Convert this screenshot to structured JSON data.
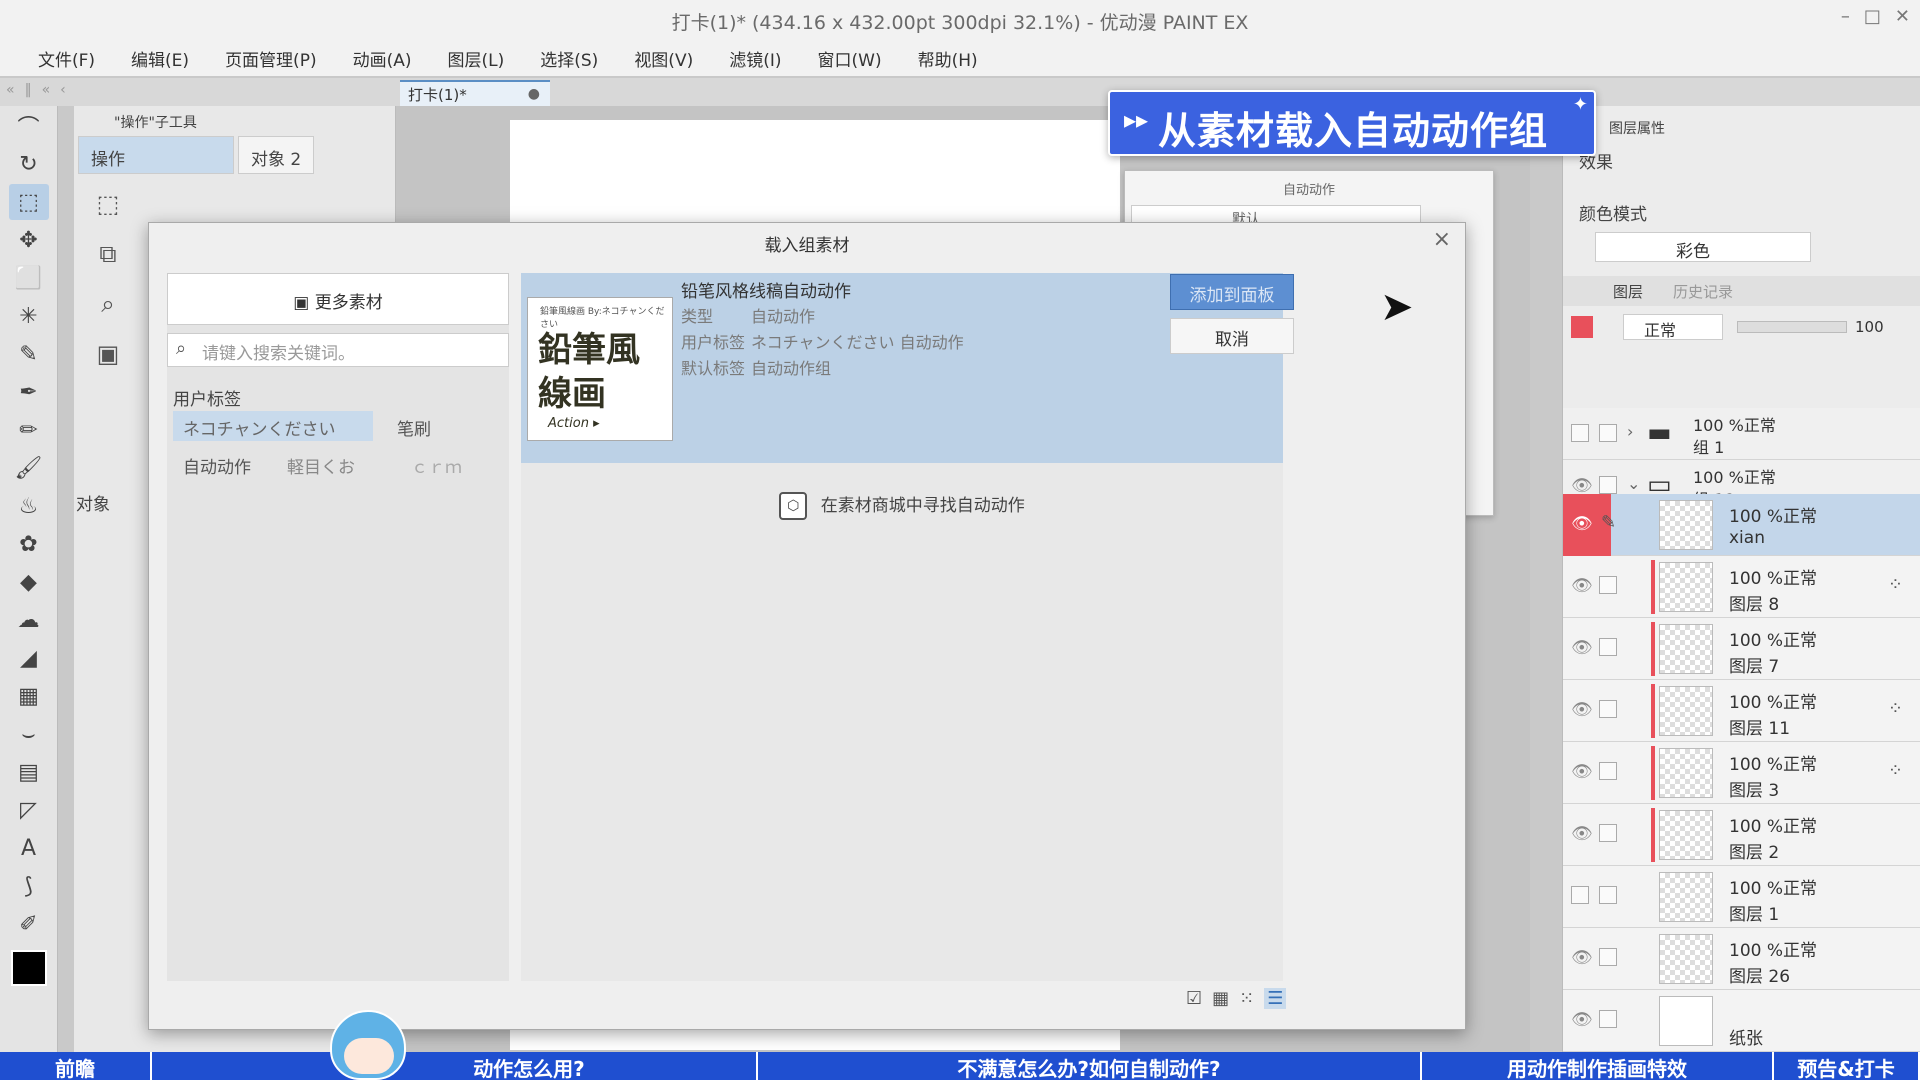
{
  "window": {
    "title": "打卡(1)* (434.16 x 432.00pt 300dpi 32.1%)  - 优动漫 PAINT EX",
    "controls": [
      "–",
      "□",
      "✕"
    ]
  },
  "menu": [
    "文件(F)",
    "编辑(E)",
    "页面管理(P)",
    "动画(A)",
    "图层(L)",
    "选择(S)",
    "视图(V)",
    "滤镜(I)",
    "窗口(W)",
    "帮助(H)"
  ],
  "doc_tab": {
    "label": "打卡(1)*",
    "dot": "●"
  },
  "subtool": {
    "header": "\"操作\"子工具",
    "tab_operate": "操作",
    "tab_object": "对象 2",
    "object_label": "对象"
  },
  "banner": {
    "text": "从素材载入自动动作组"
  },
  "auto_action_panel": {
    "title": "自动动作",
    "select": "默认"
  },
  "dialog": {
    "title": "载入组素材",
    "more_materials": "更多素材",
    "search_placeholder": "请键入搜索关键词。",
    "user_tags_label": "用户标签",
    "tags": [
      "ネコチャンください",
      "笔刷",
      "自动动作",
      "軽目くお",
      "ｃｒｍ"
    ],
    "item": {
      "title": "铅笔风格线稿自动动作",
      "type_key": "类型",
      "type_value": "自动动作",
      "user_tags_key": "用户标签",
      "user_tags_value": "ネコチャンください  自动动作",
      "default_tags_key": "默认标签",
      "default_tags_value": "自动动作组",
      "thumb_top": "鉛筆風線画 By:ネコチャンください",
      "thumb_line1": "鉛筆風",
      "thumb_line2": "線画",
      "thumb_action": "Action ▸"
    },
    "find_in_store": "在素材商城中寻找自动动作",
    "add_button": "添加到面板",
    "cancel_button": "取消"
  },
  "right_panel": {
    "layer_property": "图层属性",
    "effect_label": "效果",
    "color_mode_label": "颜色模式",
    "color_mode_value": "彩色",
    "layers_tab": "图层",
    "history_tab": "历史记录",
    "blend_mode": "正常",
    "opacity": "100",
    "folders": [
      {
        "line1": "100 %正常",
        "line2": "组 1"
      },
      {
        "line1": "100 %正常",
        "line2": "组 18"
      }
    ],
    "layers": [
      {
        "line1": "100 %正常",
        "line2": "xian"
      },
      {
        "line1": "100 %正常",
        "line2": "图层 8"
      },
      {
        "line1": "100 %正常",
        "line2": "图层 7"
      },
      {
        "line1": "100 %正常",
        "line2": "图层 11"
      },
      {
        "line1": "100 %正常",
        "line2": "图层 3"
      },
      {
        "line1": "100 %正常",
        "line2": "图层 2"
      },
      {
        "line1": "100 %正常",
        "line2": "图层 1"
      },
      {
        "line1": "100 %正常",
        "line2": "图层 26"
      }
    ],
    "paper_label": "纸张"
  },
  "bottom_bar": [
    "前瞻",
    "动作怎么用?",
    "不满意怎么办?如何自制动作?",
    "用动作制作插画特效",
    "预告&打卡"
  ],
  "colors": {
    "accent": "#5d8fd2",
    "banner": "#3b62e0",
    "selected_row": "#bcd1e6",
    "bottom_bar": "#1f4fd0",
    "layer_red": "#e8505b"
  }
}
